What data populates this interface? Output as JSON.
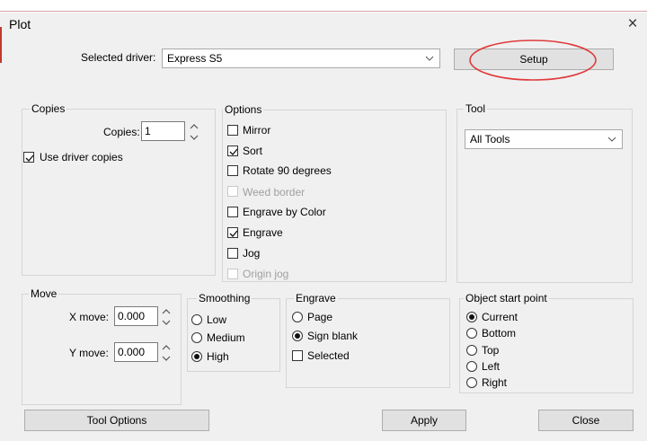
{
  "window": {
    "title": "Plot",
    "close_glyph": "×"
  },
  "driver": {
    "label": "Selected driver:",
    "value": "Express S5",
    "setup_label": "Setup"
  },
  "copies": {
    "title": "Copies",
    "copies_label": "Copies:",
    "copies_value": "1",
    "use_driver_copies_label": "Use driver copies",
    "use_driver_copies_checked": true
  },
  "options": {
    "title": "Options",
    "items": [
      {
        "label": "Mirror",
        "checked": false,
        "enabled": true
      },
      {
        "label": "Sort",
        "checked": true,
        "enabled": true
      },
      {
        "label": "Rotate 90 degrees",
        "checked": false,
        "enabled": true
      },
      {
        "label": "Weed border",
        "checked": false,
        "enabled": false
      },
      {
        "label": "Engrave by Color",
        "checked": false,
        "enabled": true
      },
      {
        "label": "Engrave",
        "checked": true,
        "enabled": true
      },
      {
        "label": "Jog",
        "checked": false,
        "enabled": true
      },
      {
        "label": "Origin jog",
        "checked": false,
        "enabled": false
      }
    ]
  },
  "tool": {
    "title": "Tool",
    "value": "All Tools"
  },
  "move": {
    "title": "Move",
    "x_label": "X move:",
    "x_value": "0.000",
    "y_label": "Y move:",
    "y_value": "0.000"
  },
  "smoothing": {
    "title": "Smoothing",
    "options": [
      "Low",
      "Medium",
      "High"
    ],
    "selected": "High"
  },
  "engrave": {
    "title": "Engrave",
    "options": [
      "Page",
      "Sign blank"
    ],
    "selected": "Sign blank",
    "selected_checkbox_label": "Selected",
    "selected_checkbox_checked": false
  },
  "start_point": {
    "title": "Object start point",
    "options": [
      "Current",
      "Bottom",
      "Top",
      "Left",
      "Right"
    ],
    "selected": "Current"
  },
  "buttons": {
    "tool_options": "Tool Options",
    "apply": "Apply",
    "close": "Close"
  },
  "colors": {
    "annotation_ellipse": "#e03a3a",
    "dialog_bg": "#f0f0f0"
  }
}
